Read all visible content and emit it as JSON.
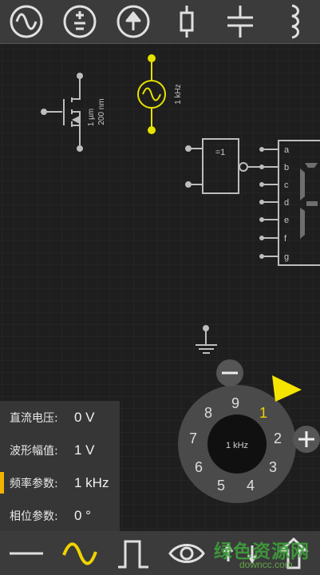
{
  "toolbar": {
    "tools": [
      {
        "icon": "ac-source-icon"
      },
      {
        "icon": "dc-source-icon"
      },
      {
        "icon": "current-source-icon"
      },
      {
        "icon": "resistor-icon"
      },
      {
        "icon": "capacitor-icon"
      },
      {
        "icon": "inductor-icon"
      }
    ]
  },
  "canvas": {
    "mosfet": {
      "width_label": "1 µm",
      "length_label": "200 nm"
    },
    "ac_source": {
      "freq_label": "1 kHz"
    },
    "xor_gate": {
      "label": "=1"
    },
    "display": {
      "pins": [
        "a",
        "b",
        "c",
        "d",
        "e",
        "f",
        "g"
      ]
    }
  },
  "dial": {
    "center_label": "1 kHz",
    "digits": [
      "9",
      "1",
      "2",
      "3",
      "4",
      "5",
      "6",
      "7",
      "8"
    ],
    "selected": "1",
    "minus": "−",
    "plus": "+"
  },
  "params": {
    "rows": [
      {
        "label": "直流电压:",
        "value": "0 V"
      },
      {
        "label": "波形幅值:",
        "value": "1 V"
      },
      {
        "label": "频率参数:",
        "value": "1 kHz"
      },
      {
        "label": "相位参数:",
        "value": "0 °"
      }
    ],
    "active_index": 2
  },
  "bottom": {
    "tools": [
      {
        "icon": "wire-icon"
      },
      {
        "icon": "sine-wave-icon"
      },
      {
        "icon": "pulse-icon"
      },
      {
        "icon": "eye-icon"
      },
      {
        "icon": "transfer-icon"
      },
      {
        "icon": "upload-icon"
      }
    ]
  },
  "watermark": {
    "title": "绿色资源网",
    "url": "downcc.com"
  },
  "colors": {
    "accent": "#f0b400",
    "selected_component": "#e6e200",
    "background": "#1e1e1e",
    "toolbar": "#3b3b3b"
  }
}
